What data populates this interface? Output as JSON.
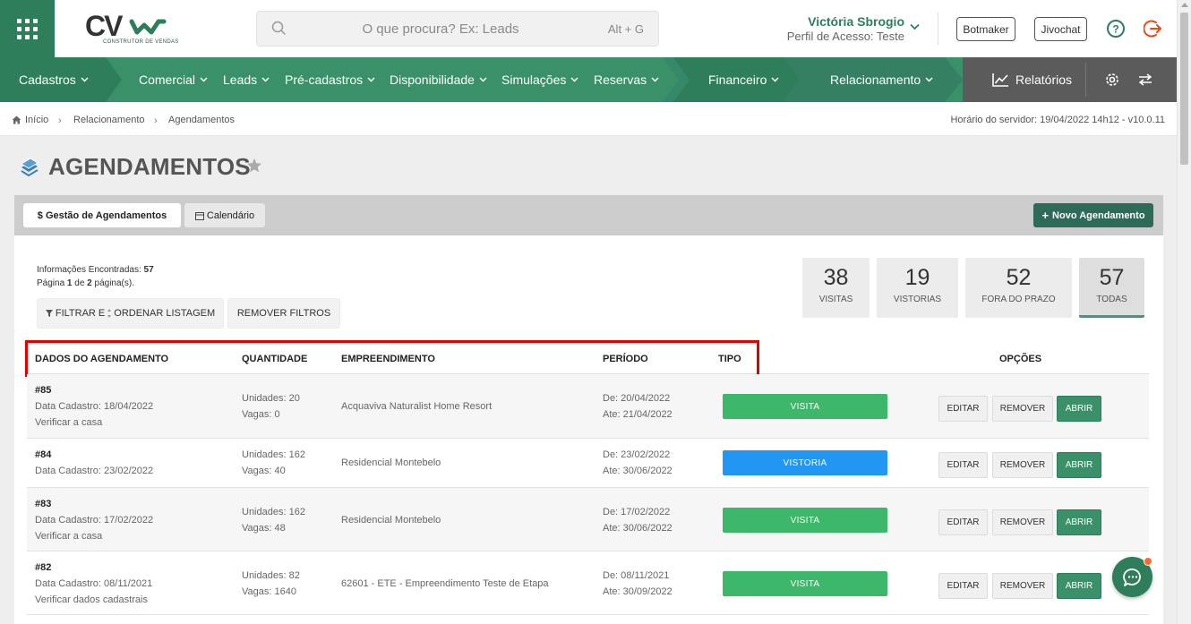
{
  "search": {
    "placeholder": "O que procura? Ex: Leads",
    "shortcut": "Alt + G"
  },
  "logo": {
    "text": "CV",
    "subtitle": "CONSTRUTOR DE VENDAS"
  },
  "user": {
    "name": "Victória Sbrogio",
    "role": "Perfil de Acesso: Teste"
  },
  "header_buttons": {
    "botmaker": "Botmaker",
    "jivochat": "Jivochat"
  },
  "nav": {
    "items": [
      {
        "label": "Cadastros"
      },
      {
        "label": "Comercial"
      },
      {
        "label": "Leads"
      },
      {
        "label": "Pré-cadastros"
      },
      {
        "label": "Disponibilidade"
      },
      {
        "label": "Simulações"
      },
      {
        "label": "Reservas"
      },
      {
        "label": "Financeiro"
      },
      {
        "label": "Relacionamento"
      }
    ],
    "reports_label": "Relatórios"
  },
  "breadcrumb": {
    "home": "Início",
    "section": "Relacionamento",
    "current": "Agendamentos"
  },
  "server_time": "Horário do servidor: 19/04/2022 14h12 - v10.0.11",
  "page": {
    "title": "AGENDAMENTOS"
  },
  "tabs": {
    "management": "$ Gestão de Agendamentos",
    "calendar": "Calendário"
  },
  "new_button": "Novo Agendamento",
  "info": {
    "found_label": "Informações Encontradas:",
    "found_count": "57",
    "page_prefix": "Página",
    "page_current": "1",
    "page_of": "de",
    "page_total": "2",
    "page_suffix": "página(s)."
  },
  "filters": {
    "filter_label": "FILTRAR E",
    "order_label": "ORDENAR LISTAGEM",
    "remove_label": "REMOVER FILTROS"
  },
  "stats": [
    {
      "value": "38",
      "label": "VISITAS"
    },
    {
      "value": "19",
      "label": "VISTORIAS"
    },
    {
      "value": "52",
      "label": "FORA DO PRAZO"
    },
    {
      "value": "57",
      "label": "TODAS"
    }
  ],
  "table": {
    "headers": {
      "dados": "DADOS DO AGENDAMENTO",
      "quantidade": "QUANTIDADE",
      "empreendimento": "EMPREENDIMENTO",
      "periodo": "PERÍODO",
      "tipo": "TIPO",
      "opcoes": "OPÇÕES"
    },
    "rows": [
      {
        "id": "#85",
        "cadastro": "Data Cadastro: 18/04/2022",
        "note": "Verificar a casa",
        "unidades": "Unidades: 20",
        "vagas": "Vagas: 0",
        "empreendimento": "Acquaviva Naturalist Home Resort",
        "de": "De: 20/04/2022",
        "ate": "Ate: 21/04/2022",
        "tipo": "VISITA"
      },
      {
        "id": "#84",
        "cadastro": "Data Cadastro: 23/02/2022",
        "note": "",
        "unidades": "Unidades: 162",
        "vagas": "Vagas: 40",
        "empreendimento": "Residencial Montebelo",
        "de": "De: 23/02/2022",
        "ate": "Ate: 30/06/2022",
        "tipo": "VISTORIA"
      },
      {
        "id": "#83",
        "cadastro": "Data Cadastro: 17/02/2022",
        "note": "Verificar a casa",
        "unidades": "Unidades: 162",
        "vagas": "Vagas: 48",
        "empreendimento": "Residencial Montebelo",
        "de": "De: 17/02/2022",
        "ate": "Ate: 30/06/2022",
        "tipo": "VISITA"
      },
      {
        "id": "#82",
        "cadastro": "Data Cadastro: 08/11/2021",
        "note": "Verificar dados cadastrais",
        "unidades": "Unidades: 82",
        "vagas": "Vagas: 1640",
        "empreendimento": "62601 - ETE - Empreendimento Teste de Etapa",
        "de": "De: 08/11/2021",
        "ate": "Ate: 30/09/2022",
        "tipo": "VISITA"
      }
    ],
    "actions": {
      "edit": "EDITAR",
      "remove": "REMOVER",
      "open": "ABRIR"
    }
  },
  "colors": {
    "brand": "#2e7d5b",
    "visita": "#3db76a",
    "vistoria": "#2196f3",
    "highlight": "#e00000"
  }
}
